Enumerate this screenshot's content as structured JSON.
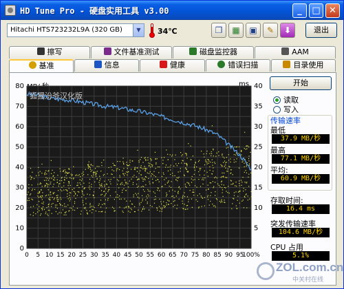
{
  "window": {
    "title": "HD Tune Pro - 硬盘实用工具 v3.00"
  },
  "toolbar": {
    "drive": "Hitachi HTS723232L9A (320 GB)",
    "temperature": "34℃",
    "exit_label": "退出"
  },
  "tabs_top": [
    {
      "label": "擦写",
      "icon": "trash-icon",
      "color": "#333333"
    },
    {
      "label": "文件基准测试",
      "icon": "document-icon",
      "color": "#7a2c8a"
    },
    {
      "label": "磁盘监控器",
      "icon": "monitor-chart-icon",
      "color": "#2a7a2a"
    },
    {
      "label": "AAM",
      "icon": "speaker-icon",
      "color": "#555555"
    }
  ],
  "tabs_bottom": [
    {
      "label": "基准",
      "icon": "lightbulb-icon",
      "color": "#d4a000",
      "active": true
    },
    {
      "label": "信息",
      "icon": "info-icon",
      "color": "#1d56c4"
    },
    {
      "label": "健康",
      "icon": "health-cross-icon",
      "color": "#d81818"
    },
    {
      "label": "错误扫描",
      "icon": "magnifier-icon",
      "color": "#2a7a2a"
    },
    {
      "label": "目录使用",
      "icon": "folder-icon",
      "color": "#c98a00"
    }
  ],
  "chart_labels": {
    "left_unit": "MB/ 秒",
    "right_unit": "ms",
    "watermark": "狐狸汾爷汉化版"
  },
  "side": {
    "start_label": "开始",
    "radio_read": "读取",
    "radio_write": "写入",
    "group_title": "传输速率",
    "min_label": "最低",
    "min_value": "37.9 MB/秒",
    "max_label": "最高",
    "max_value": "77.1 MB/秒",
    "avg_label": "平均:",
    "avg_value": "60.9 MB/秒",
    "access_label": "存取时间:",
    "access_value": "16.4 ms",
    "burst_label": "突发传输速率",
    "burst_value": "104.6 MB/秒",
    "cpu_label": "CPU 占用",
    "cpu_value": "5.1%"
  },
  "logo": {
    "main": "ZOL.com.cn",
    "sub": "中关村在线"
  },
  "chart_data": {
    "type": "line",
    "x": [
      0,
      5,
      10,
      15,
      20,
      25,
      30,
      35,
      40,
      45,
      50,
      55,
      60,
      65,
      70,
      75,
      80,
      85,
      90,
      95,
      100
    ],
    "xticks": [
      "0",
      "5",
      "10",
      "15",
      "20",
      "25",
      "30",
      "35",
      "40",
      "45",
      "50",
      "55",
      "60",
      "65",
      "70",
      "75",
      "80",
      "85",
      "90",
      "95",
      "100%"
    ],
    "xlim": [
      0,
      100
    ],
    "ylim": [
      0,
      80
    ],
    "yticks": [
      0,
      10,
      20,
      30,
      40,
      50,
      60,
      70,
      80
    ],
    "y2lim": [
      0,
      40
    ],
    "y2ticks": [
      5,
      10,
      15,
      20,
      25,
      30,
      35,
      40
    ],
    "ylabel": "MB/ 秒",
    "y2label": "ms",
    "series": [
      {
        "color": "#5aa0e6",
        "values": [
          76,
          75.5,
          74,
          73.5,
          73,
          72,
          71,
          70,
          69.5,
          68.5,
          67.5,
          66.5,
          65,
          63.5,
          62,
          60.5,
          58.5,
          56,
          51,
          46,
          39
        ]
      }
    ],
    "scatter": {
      "color": "#e6e64a",
      "axis": "right",
      "y_range_start": [
        8,
        19
      ],
      "y_range_end": [
        10,
        26
      ]
    },
    "grid": true
  }
}
